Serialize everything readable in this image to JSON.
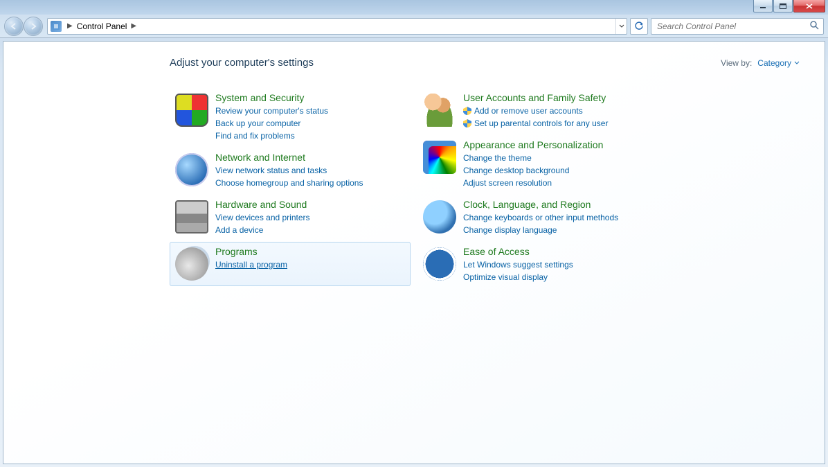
{
  "breadcrumb": {
    "current": "Control Panel"
  },
  "search": {
    "placeholder": "Search Control Panel"
  },
  "page_title": "Adjust your computer's settings",
  "viewby": {
    "label": "View by:",
    "value": "Category"
  },
  "left": [
    {
      "title": "System and Security",
      "tasks": [
        "Review your computer's status",
        "Back up your computer",
        "Find and fix problems"
      ]
    },
    {
      "title": "Network and Internet",
      "tasks": [
        "View network status and tasks",
        "Choose homegroup and sharing options"
      ]
    },
    {
      "title": "Hardware and Sound",
      "tasks": [
        "View devices and printers",
        "Add a device"
      ]
    },
    {
      "title": "Programs",
      "tasks": [
        "Uninstall a program"
      ]
    }
  ],
  "right": [
    {
      "title": "User Accounts and Family Safety",
      "tasks": [
        "Add or remove user accounts",
        "Set up parental controls for any user"
      ],
      "shielded": [
        true,
        true
      ]
    },
    {
      "title": "Appearance and Personalization",
      "tasks": [
        "Change the theme",
        "Change desktop background",
        "Adjust screen resolution"
      ]
    },
    {
      "title": "Clock, Language, and Region",
      "tasks": [
        "Change keyboards or other input methods",
        "Change display language"
      ]
    },
    {
      "title": "Ease of Access",
      "tasks": [
        "Let Windows suggest settings",
        "Optimize visual display"
      ]
    }
  ]
}
